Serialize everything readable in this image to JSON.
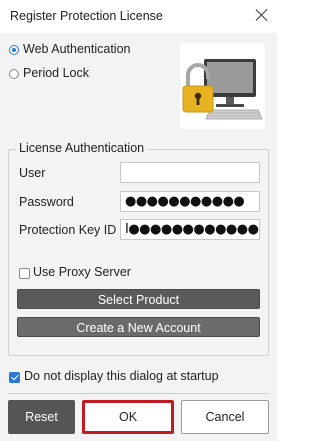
{
  "window": {
    "title": "Register Protection License"
  },
  "mode": {
    "options": [
      {
        "label": "Web Authentication",
        "selected": true
      },
      {
        "label": "Period Lock",
        "selected": false
      }
    ]
  },
  "license_auth": {
    "legend": "License Authentication",
    "user_label": "User",
    "user_value": "",
    "password_label": "Password",
    "password_value": "●●●●●●●●●●●",
    "key_label": "Protection Key ID",
    "key_value": "I●●●●●●●●●●●●",
    "proxy_label": "Use Proxy Server",
    "proxy_checked": false,
    "select_product_label": "Select Product",
    "create_account_label": "Create a New Account"
  },
  "startup": {
    "label": "Do not display this dialog at startup",
    "checked": true
  },
  "buttons": {
    "reset": "Reset",
    "ok": "OK",
    "cancel": "Cancel"
  },
  "colors": {
    "accent": "#2b78d3",
    "focus_border": "#c21b21",
    "dark_button": "#5a5a5a",
    "lock": "#e8b321"
  }
}
